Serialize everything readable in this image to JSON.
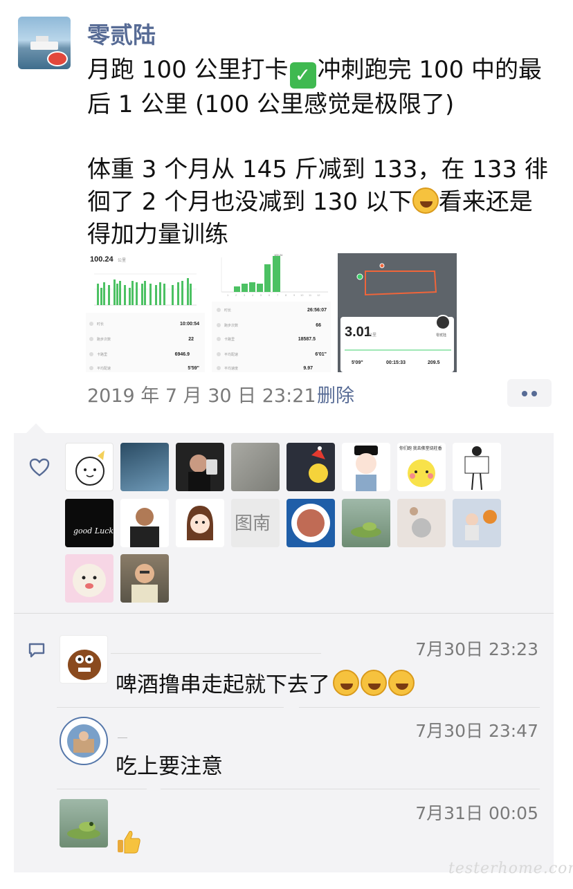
{
  "post": {
    "author": "零贰陆",
    "line1": "月跑 100 公里打卡",
    "line1b": "冲刺跑完 100 中的最",
    "line2": "后 1 公里 (100 公里感觉是极限了)",
    "line3": "体重 3 个月从 145 斤减到 133，在 133 徘",
    "line4a": "徊了 2 个月也没减到 130 以下",
    "line4b": "看来还是",
    "line5": "得加力量训练",
    "timestamp": "2019 年 7 月 30 日  23:21",
    "delete_label": "删除"
  },
  "images": {
    "img1": {
      "total": "100.24",
      "unit": "公里",
      "rows": [
        {
          "label": "时长",
          "value": "10:00:54"
        },
        {
          "label": "跑步次数",
          "value": "22",
          "unit": "次"
        },
        {
          "label": "卡路里",
          "value": "6946.9",
          "unit": "千卡"
        },
        {
          "label": "平均配速",
          "value": "5'59\""
        }
      ]
    },
    "img2": {
      "peak": "100.24",
      "rows": [
        {
          "label": "时长",
          "value": "26:56:07"
        },
        {
          "label": "跑步次数",
          "value": "66",
          "unit": "次"
        },
        {
          "label": "卡路里",
          "value": "18587.5",
          "unit": "千卡"
        },
        {
          "label": "平均配速",
          "value": "6'01\""
        },
        {
          "label": "平均速度",
          "value": "9.97",
          "unit": "公里/时"
        }
      ]
    },
    "img3": {
      "distance": "3.01",
      "unit": "公里",
      "name": "零贰陆",
      "pace": "5'09\"",
      "duration": "00:15:33",
      "calories": "209.5"
    }
  },
  "comments": [
    {
      "time": "7月30日 23:23",
      "text": "啤酒撸串走起就下去了"
    },
    {
      "time": "7月30日 23:47",
      "text": "吃上要注意"
    },
    {
      "time": "7月31日 00:05",
      "text": ""
    }
  ],
  "liker_images": {
    "row2_4_text": "图南",
    "row1_7_text": "你们跑 我去佛堂烧柱香",
    "row2_1_text": "good Luck"
  },
  "watermark": "testerhome.com",
  "colors": {
    "link": "#576b95",
    "panel_bg": "#f3f3f5",
    "meta": "#7a7a7a"
  }
}
